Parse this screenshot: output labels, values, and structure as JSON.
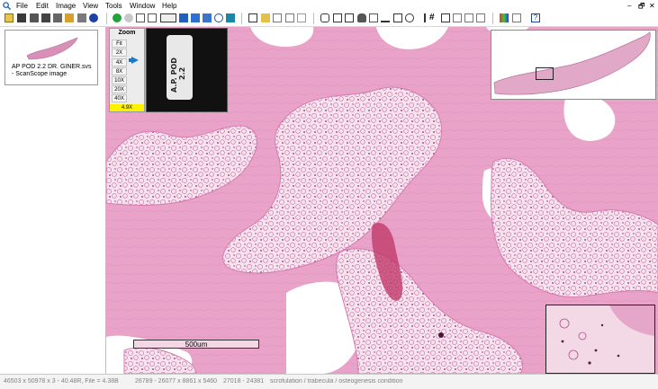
{
  "menubar": {
    "items": [
      "File",
      "Edit",
      "Image",
      "View",
      "Tools",
      "Window",
      "Help"
    ],
    "window_controls": [
      "–",
      "🗗",
      "✕"
    ]
  },
  "toolbar": {
    "icons": [
      "open-folder-icon",
      "save-icon",
      "print-icon",
      "copy-icon",
      "export-icon",
      "snapshot-icon",
      "properties-icon",
      "info-icon",
      "go-icon",
      "stop-icon",
      "network-icon",
      "link-icon",
      "select-region-icon",
      "dual-view-icon",
      "overview-icon",
      "magnifier-icon",
      "zoom-window-icon",
      "refresh-icon",
      "annotation-edit-icon",
      "annotation-folder-icon",
      "annotation-import-icon",
      "annotation-export-icon",
      "pan-hand-icon",
      "pointer-icon",
      "crop-icon",
      "arrow-select-icon",
      "pen-icon",
      "ruler-icon",
      "rectangle-tool-icon",
      "ellipse-tool-icon",
      "arrow-tool-icon",
      "grid-icon",
      "counter-icon",
      "compare-icon",
      "layers-icon",
      "color-adjust-icon",
      "filter-icon",
      "help-icon"
    ]
  },
  "thumbnail": {
    "label": "AP POD 2.2 DR. GINER.svs - ScanScope image"
  },
  "zoom": {
    "title": "Zoom",
    "levels": [
      "Fit",
      "2X",
      "4X",
      "8X",
      "10X",
      "20X",
      "40X"
    ],
    "current": "4.9X"
  },
  "slide_label": {
    "line1": "A.P. POD",
    "line2": "2.2"
  },
  "scalebar": {
    "label": "500um"
  },
  "statusbar": {
    "segments": [
      "46503 x 50978 x 3 - 40.48R, File = 4.38B",
      "26789 - 26077 x 8861 x 5460",
      "27018 - 24381",
      "scrofulation / trabecula / osteogenesis condition"
    ]
  },
  "colors": {
    "stroma": "#e9a3c9",
    "marrow": "#f6dbe8",
    "accent_yellow": "#fff200",
    "arrow_blue": "#1b78c9"
  }
}
